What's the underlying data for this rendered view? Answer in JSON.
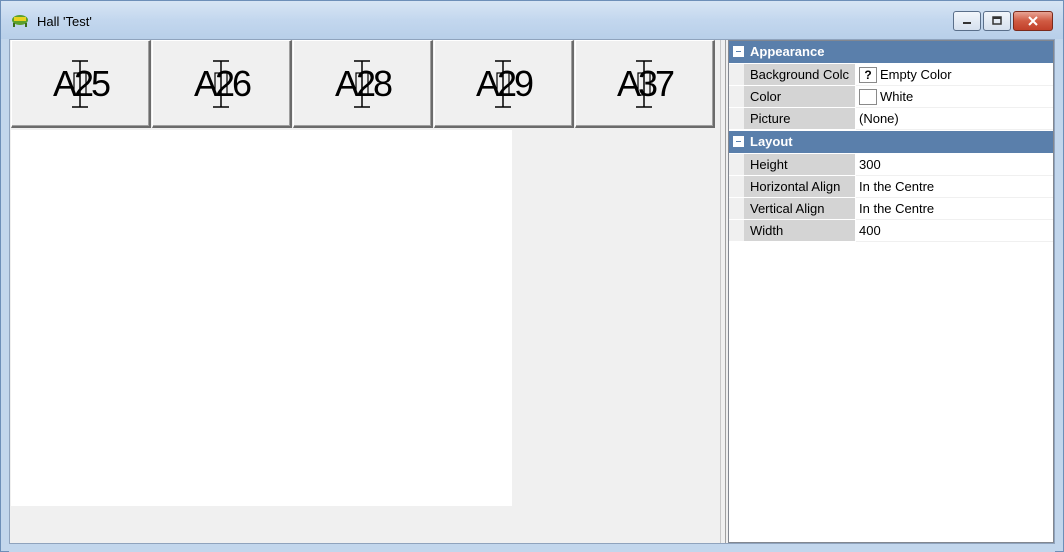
{
  "window": {
    "title": "Hall 'Test'",
    "icons": {
      "app": "hall-app-icon",
      "minimize": "minimize-icon",
      "maximize": "maximize-icon",
      "close": "close-icon"
    }
  },
  "seats": [
    {
      "label": "A25"
    },
    {
      "label": "A26"
    },
    {
      "label": "A28"
    },
    {
      "label": "A29"
    },
    {
      "label": "A37"
    }
  ],
  "propgrid": {
    "categories": [
      {
        "label": "Appearance",
        "props": [
          {
            "name": "Background Colc",
            "value": "Empty Color",
            "swatch": "?"
          },
          {
            "name": "Color",
            "value": "White",
            "swatch": ""
          },
          {
            "name": "Picture",
            "value": "(None)"
          }
        ]
      },
      {
        "label": "Layout",
        "props": [
          {
            "name": "Height",
            "value": "300"
          },
          {
            "name": "Horizontal Align",
            "value": "In the Centre"
          },
          {
            "name": "Vertical Align",
            "value": "In the Centre"
          },
          {
            "name": "Width",
            "value": "400"
          }
        ]
      }
    ]
  },
  "colors": {
    "category_bg": "#5a7fab",
    "name_col_bg": "#d4d4d4",
    "canvas_bg": "#ffffff"
  }
}
